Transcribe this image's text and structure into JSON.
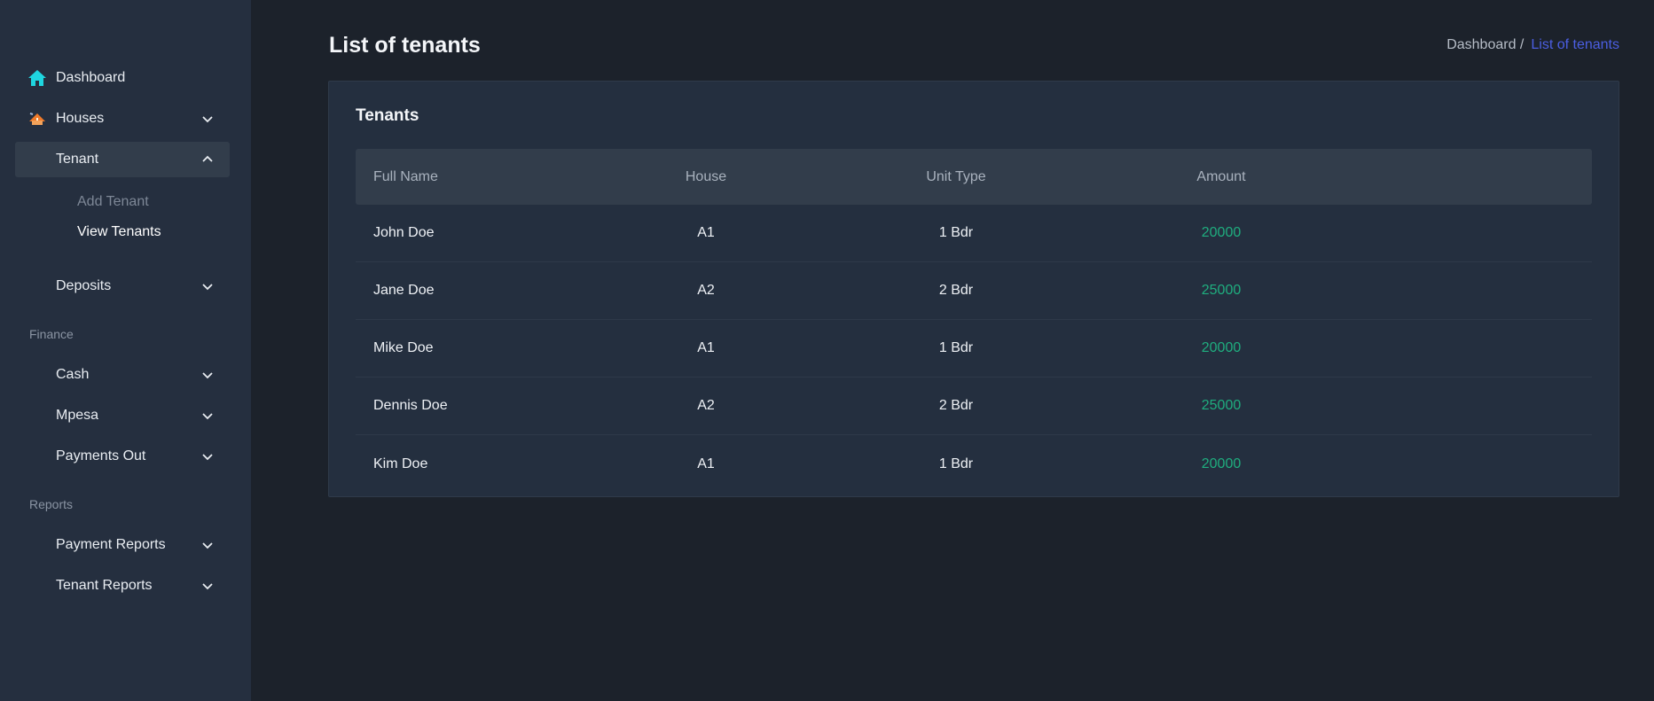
{
  "sidebar": {
    "items": [
      {
        "label": "Dashboard",
        "icon": "home-icon",
        "expandable": false
      },
      {
        "label": "Houses",
        "icon": "house-icon",
        "expandable": true,
        "expanded": false
      },
      {
        "label": "Tenant",
        "expandable": true,
        "expanded": true,
        "active": true,
        "children": [
          {
            "label": "Add Tenant",
            "current": false
          },
          {
            "label": "View Tenants",
            "current": true
          }
        ]
      },
      {
        "label": "Deposits",
        "expandable": true,
        "expanded": false
      }
    ],
    "sections": [
      {
        "title": "Finance",
        "items": [
          {
            "label": "Cash",
            "expandable": true
          },
          {
            "label": "Mpesa",
            "expandable": true
          },
          {
            "label": "Payments Out",
            "expandable": true
          }
        ]
      },
      {
        "title": "Reports",
        "items": [
          {
            "label": "Payment Reports",
            "expandable": true
          },
          {
            "label": "Tenant Reports",
            "expandable": true
          }
        ]
      }
    ]
  },
  "header": {
    "title": "List of tenants",
    "breadcrumb": [
      {
        "label": "Dashboard /",
        "link": true
      },
      {
        "label": "List of tenants",
        "active": true
      }
    ]
  },
  "card": {
    "title": "Tenants",
    "table": {
      "columns": [
        "Full Name",
        "House",
        "Unit Type",
        "Amount"
      ],
      "rows": [
        {
          "name": "John Doe",
          "house": "A1",
          "unit": "1 Bdr",
          "amount": "20000"
        },
        {
          "name": "Jane Doe",
          "house": "A2",
          "unit": "2 Bdr",
          "amount": "25000"
        },
        {
          "name": "Mike Doe",
          "house": "A1",
          "unit": "1 Bdr",
          "amount": "20000"
        },
        {
          "name": "Dennis Doe",
          "house": "A2",
          "unit": "2 Bdr",
          "amount": "25000"
        },
        {
          "name": "Kim Doe",
          "house": "A1",
          "unit": "1 Bdr",
          "amount": "20000"
        }
      ]
    }
  },
  "colors": {
    "sidebar_bg": "#252f3f",
    "page_bg": "#1c222b",
    "card_bg": "#242f3f",
    "accent_blue": "#4b5ee2",
    "amount_green": "#1fae7f",
    "home_icon": "#1fd6e0",
    "house_icon": "#ef7a2a"
  }
}
